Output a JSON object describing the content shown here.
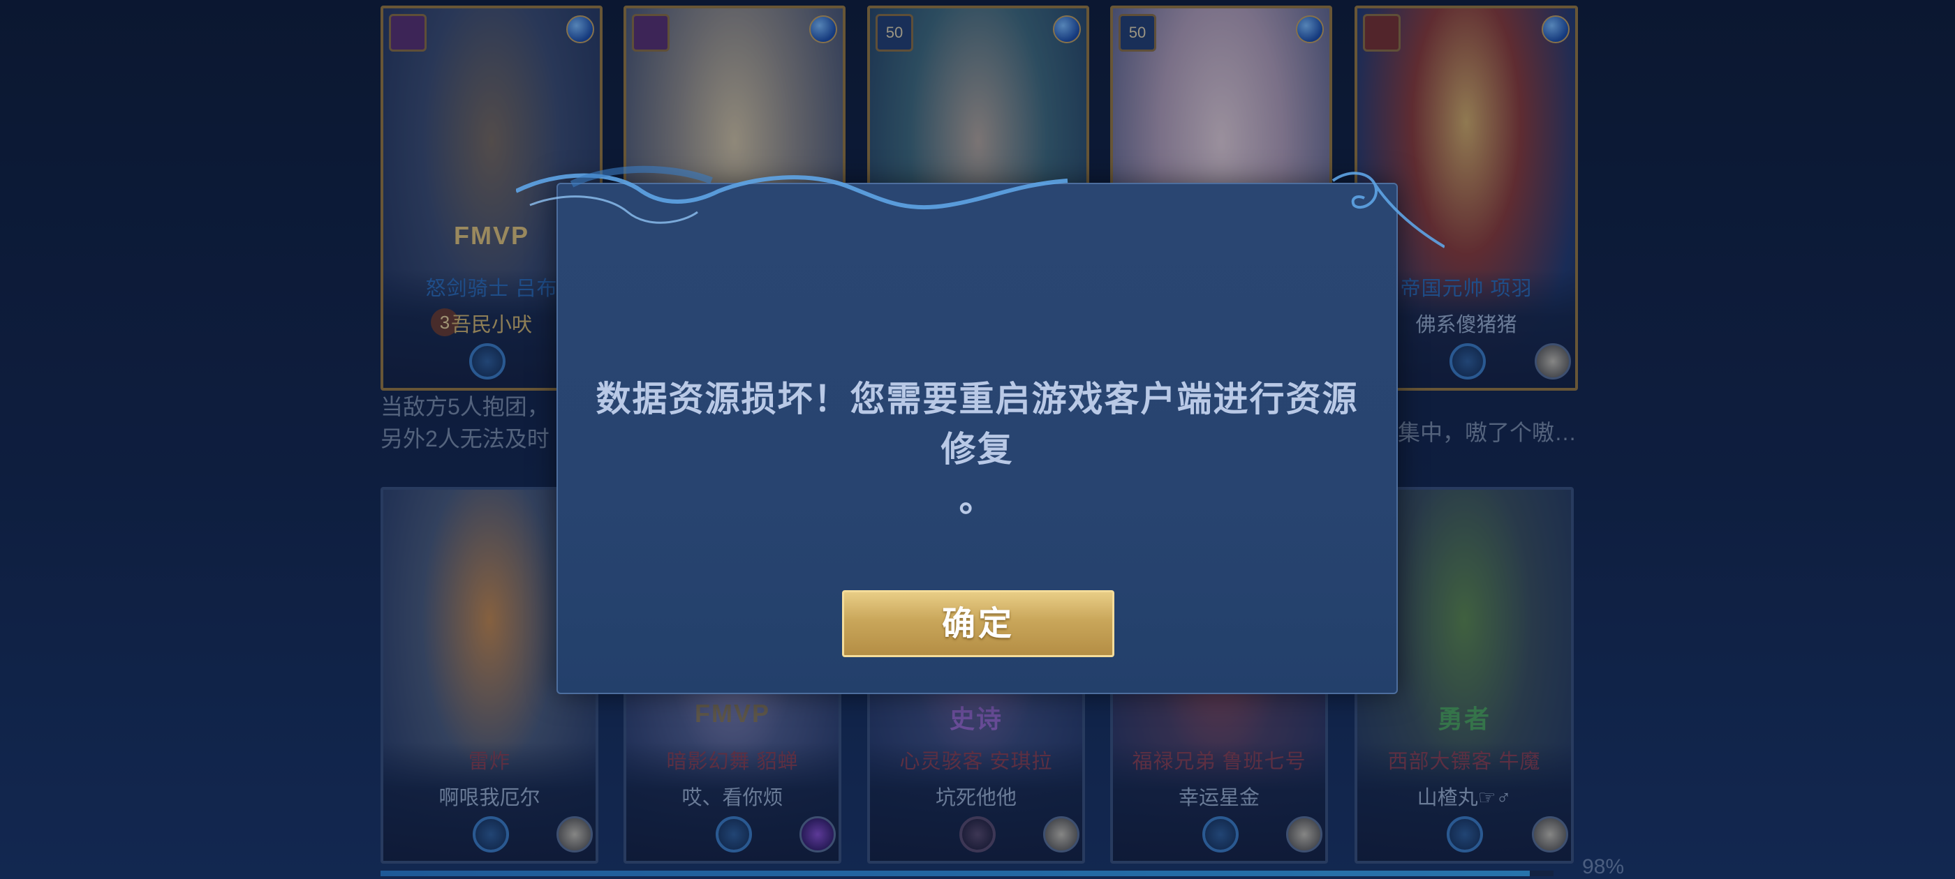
{
  "top_cards": [
    {
      "badge": "",
      "tag": "FMVP",
      "hero": "怒剑骑士 吕布",
      "player": "吾民小吠",
      "level": "3"
    },
    {
      "badge": "",
      "tag": "",
      "hero": "",
      "player": "",
      "level": ""
    },
    {
      "badge": "50",
      "tag": "",
      "hero": "",
      "player": "",
      "level": ""
    },
    {
      "badge": "50",
      "tag": "",
      "hero": "",
      "player": "",
      "level": ""
    },
    {
      "badge": "",
      "tag": "",
      "hero": "帝国元帅 项羽",
      "player": "佛系傻猪猪",
      "level": ""
    }
  ],
  "descriptions": {
    "left": "当敌方5人抱团，\n另外2人无法及时",
    "right": "集中，嗷了个嗷…"
  },
  "bottom_cards": [
    {
      "tag": "",
      "hero": "雷炸",
      "player": "啊哏我厄尔"
    },
    {
      "tag": "FMVP",
      "hero": "暗影幻舞 貂蝉",
      "player": "哎、看你烦"
    },
    {
      "tag": "史诗",
      "hero": "心灵骇客 安琪拉",
      "player": "坑死他他"
    },
    {
      "tag": "",
      "hero": "福禄兄弟 鲁班七号",
      "player": "幸运星金"
    },
    {
      "tag": "勇者",
      "hero": "西部大镖客 牛魔",
      "player": "山楂丸☞♂"
    }
  ],
  "dialog": {
    "message": "数据资源损坏！您需要重启游戏客户端进行资源修复\n。",
    "confirm_label": "确定"
  },
  "progress": {
    "value": 0.98,
    "label": "98%"
  },
  "colors": {
    "dialog_bg": "#2a4672",
    "button_gold": "#c9a65a",
    "text_light_blue": "#b9c9e6"
  }
}
